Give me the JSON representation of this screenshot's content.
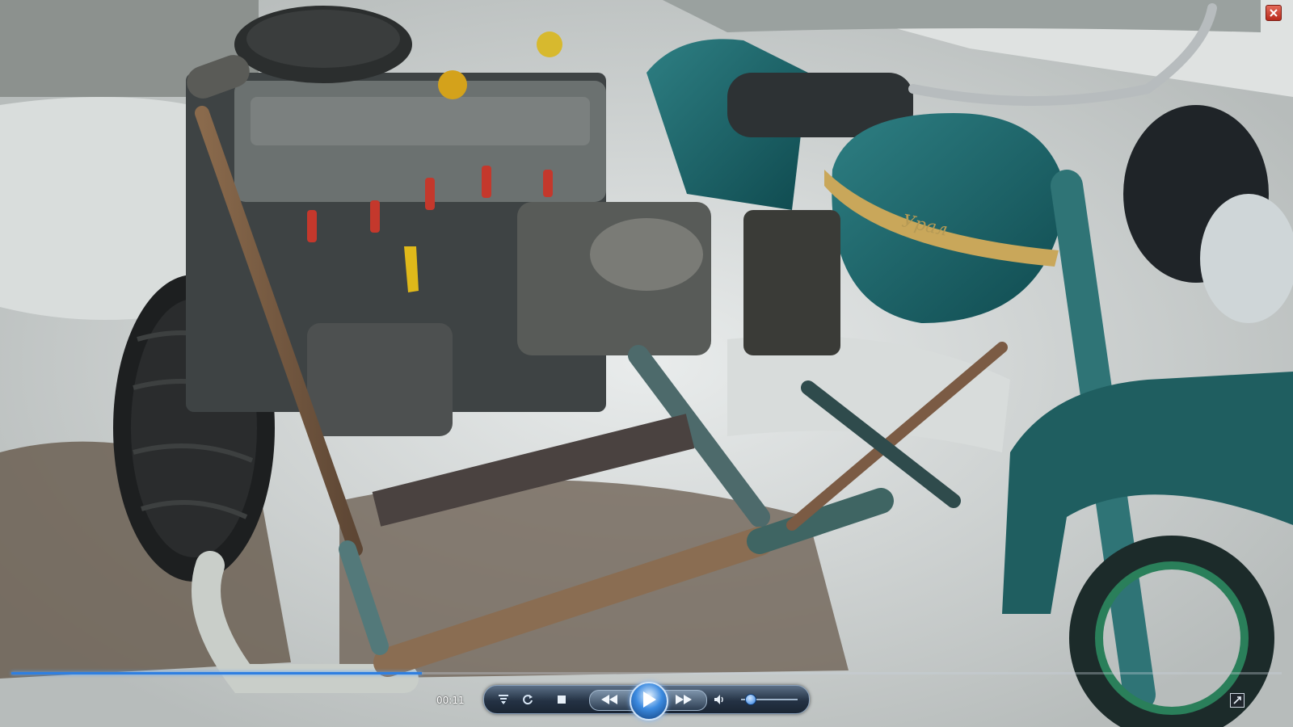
{
  "player": {
    "elapsed": "00:11",
    "progress_fraction": 0.323,
    "volume_fraction": 0.15
  },
  "video": {
    "tank_emblem": "Урал"
  },
  "icons": {
    "close": "close-icon",
    "playlist": "playlist-icon",
    "repeat": "repeat-icon",
    "stop": "stop-icon",
    "previous": "previous-icon",
    "play": "play-icon",
    "next": "next-icon",
    "mute": "speaker-icon",
    "fullscreen": "fullscreen-icon"
  }
}
